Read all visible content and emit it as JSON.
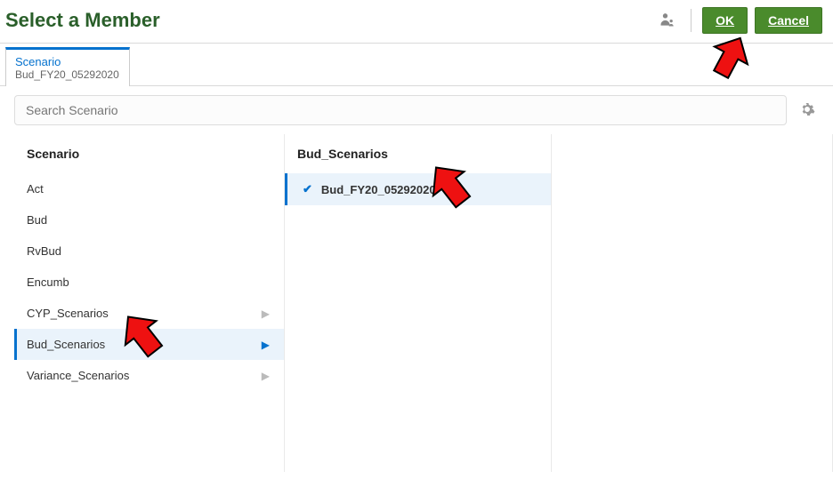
{
  "header": {
    "title": "Select a Member",
    "ok_label": "OK",
    "cancel_label": "Cancel"
  },
  "tab": {
    "label": "Scenario",
    "value": "Bud_FY20_05292020"
  },
  "search": {
    "placeholder": "Search Scenario"
  },
  "column1": {
    "header": "Scenario",
    "items": [
      {
        "label": "Act",
        "has_children": false,
        "selected": false
      },
      {
        "label": "Bud",
        "has_children": false,
        "selected": false
      },
      {
        "label": "RvBud",
        "has_children": false,
        "selected": false
      },
      {
        "label": "Encumb",
        "has_children": false,
        "selected": false
      },
      {
        "label": "CYP_Scenarios",
        "has_children": true,
        "selected": false
      },
      {
        "label": "Bud_Scenarios",
        "has_children": true,
        "selected": true
      },
      {
        "label": "Variance_Scenarios",
        "has_children": true,
        "selected": false
      }
    ]
  },
  "column2": {
    "header": "Bud_Scenarios",
    "items": [
      {
        "label": "Bud_FY20_05292020",
        "checked": true,
        "selected": true
      }
    ]
  }
}
